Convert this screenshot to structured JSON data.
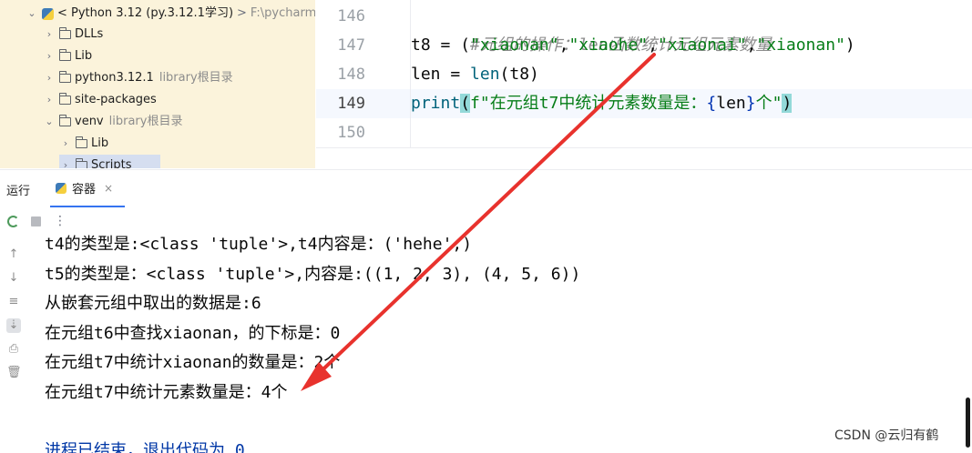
{
  "project_tree": {
    "breadcrumb": {
      "root_label": "< Python 3.12 (py.3.12.1学习)",
      "separator": ">",
      "path": "F:\\pycharm-l"
    },
    "items": [
      {
        "label": "DLLs",
        "note": ""
      },
      {
        "label": "Lib",
        "note": ""
      },
      {
        "label": "python3.12.1",
        "note": "library根目录"
      },
      {
        "label": "site-packages",
        "note": ""
      },
      {
        "label": "venv",
        "note": "library根目录"
      },
      {
        "label": "Lib",
        "note": ""
      },
      {
        "label": "Scripts",
        "note": ""
      }
    ]
  },
  "editor": {
    "lines": [
      {
        "number": "146",
        "comment": "#元组的操作：len函数统计元组元素数量"
      },
      {
        "number": "147",
        "var": "t8",
        "op": " = (",
        "s1": "\"xiaonan\"",
        "s2": "\"xiaohe\"",
        "s3": "\"xiaonai\"",
        "s4": "\"xiaonan\"",
        "comma": ",",
        "close": ")"
      },
      {
        "number": "148",
        "lhs": "len = ",
        "fn": "len",
        "args": "(t8)"
      },
      {
        "number": "149",
        "fn": "print",
        "open": "(",
        "fpre": "f\"在元组t7中统计元素数量是：",
        "lbrace": "{",
        "var": "len",
        "rbrace": "}",
        "fpost": "个\"",
        "close": ")"
      },
      {
        "number": "150"
      }
    ]
  },
  "run_window": {
    "title": "运行",
    "tab_label": "容器",
    "tab_close": "×",
    "more_glyph": "⋮",
    "output": [
      "t4的类型是:<class 'tuple'>,t4内容是：('hehe',)",
      "t5的类型是：<class 'tuple'>,内容是:((1, 2, 3), (4, 5, 6))",
      "从嵌套元组中取出的数据是:6",
      "在元组t6中查找xiaonan，的下标是：0",
      "在元组t7中统计xiaonan的数量是：2个",
      "在元组t7中统计元素数量是：4个",
      "",
      "进程已结束，退出代码为 0"
    ]
  },
  "watermark": "CSDN @云归有鹤",
  "colors": {
    "tree_bg": "#fbf3db",
    "string": "#067d17",
    "keyword_fn": "#00627a",
    "brace_highlight": "#93d9d9",
    "annotation_arrow": "#e8322d",
    "exit_text": "#0037a6"
  }
}
